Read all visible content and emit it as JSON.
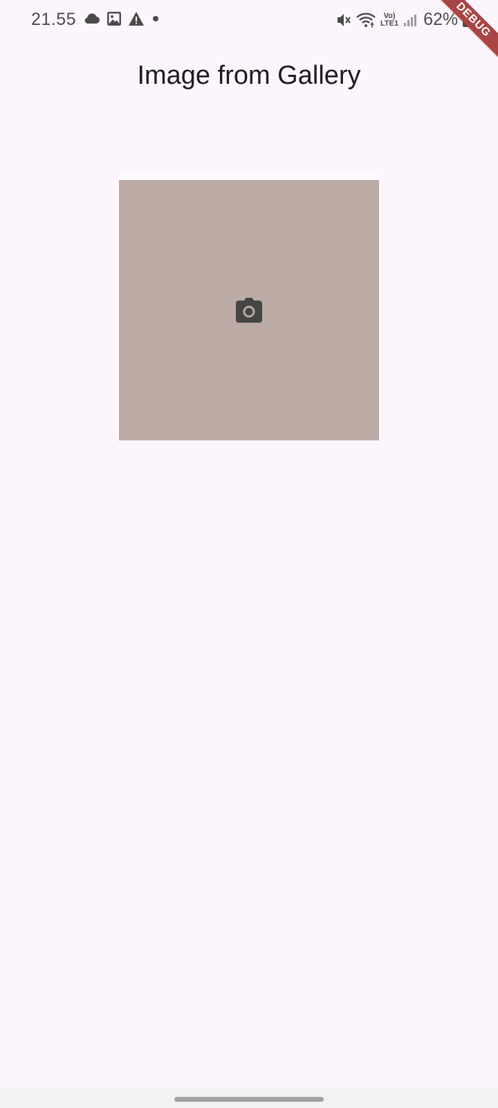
{
  "status_bar": {
    "time": "21.55",
    "left_icons": [
      "cloud-icon",
      "image-icon",
      "warning-icon",
      "dot-icon"
    ],
    "right_icons": [
      "mute-icon",
      "wifi-icon",
      "volte-lte-icon",
      "signal-icon",
      "battery-icon"
    ],
    "volte_label_top": "Vo)",
    "volte_label_bottom": "LTE1",
    "battery": "62%"
  },
  "debug_banner": {
    "label": "DEBUG"
  },
  "app_bar": {
    "title": "Image from Gallery"
  },
  "image_placeholder": {
    "icon": "camera-icon",
    "background_color": "#bcaba5",
    "icon_color": "#454545"
  },
  "colors": {
    "page_background": "#fcf6fc",
    "debug_banner": "#a94444"
  }
}
